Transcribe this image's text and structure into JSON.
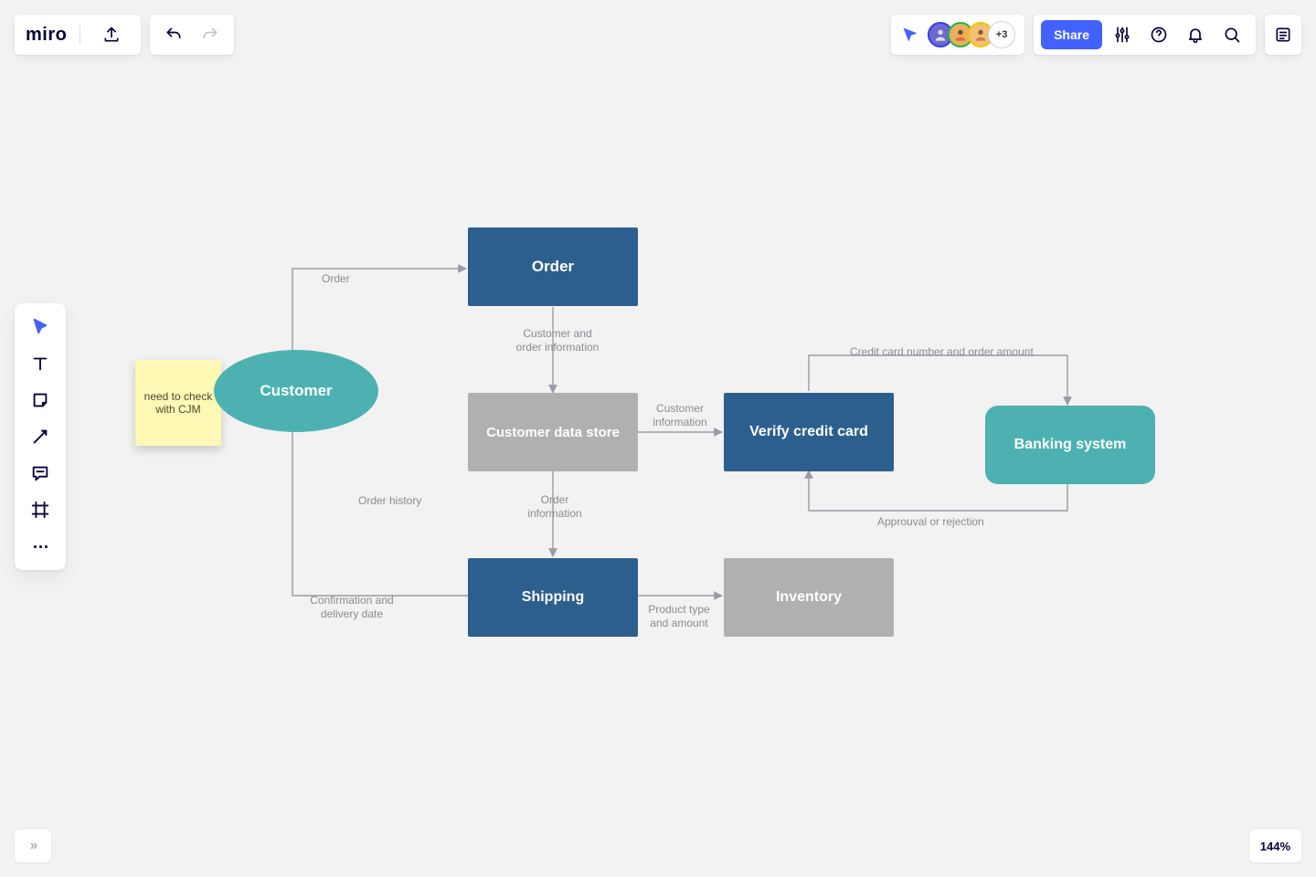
{
  "app": {
    "logo": "miro"
  },
  "header": {
    "share_label": "Share",
    "avatar_extra": "+3"
  },
  "zoom_level": "144%",
  "sticky": {
    "text": "need to check with CJM"
  },
  "nodes": {
    "customer": "Customer",
    "order": "Order",
    "cds": "Customer data store",
    "verify": "Verify credit card",
    "banking": "Banking system",
    "shipping": "Shipping",
    "inventory": "Inventory"
  },
  "edges": {
    "order": "Order",
    "cust_order_info": "Customer and order information",
    "cust_info": "Customer information",
    "cc_amount": "Credit card number and order amount",
    "approval": "Approuval or rejection",
    "order_info": "Order information",
    "order_history": "Order history",
    "confirm": "Confirmation and delivery date",
    "product": "Product type and amount"
  }
}
